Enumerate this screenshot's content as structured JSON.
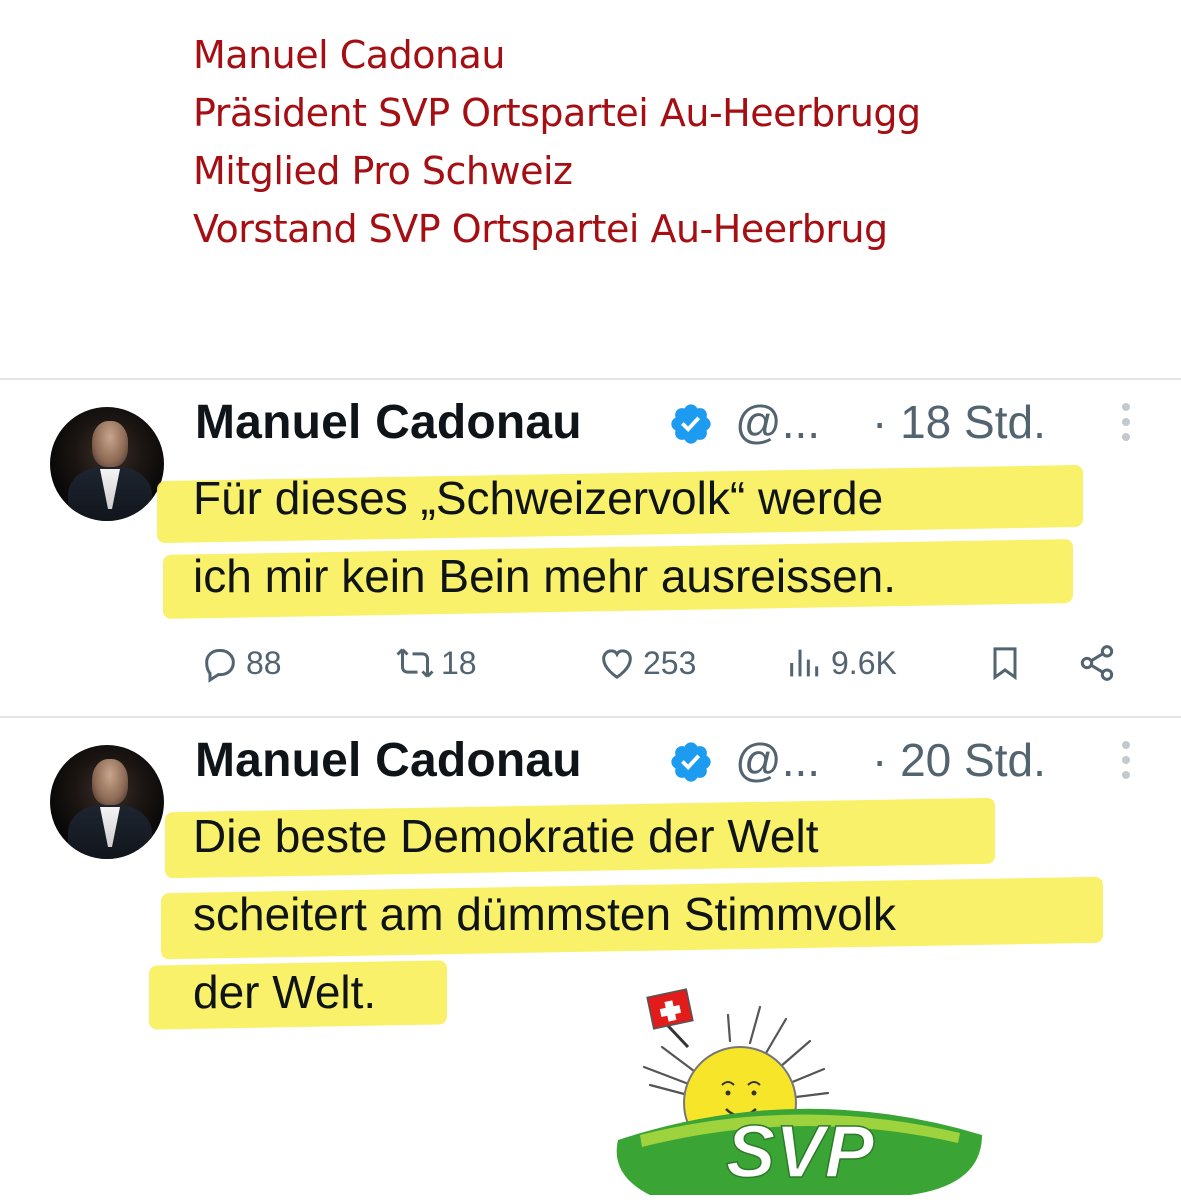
{
  "caption": {
    "lines": [
      "Manuel Cadonau",
      "Präsident SVP Ortspartei Au-Heerbrugg",
      "Mitglied Pro Schweiz",
      "Vorstand SVP Ortspartei Au-Heerbrug"
    ],
    "color": "#a50e12"
  },
  "tweets": [
    {
      "name": "Manuel Cadonau",
      "handle": "@...",
      "time": "· 18 Std.",
      "text_lines": [
        "Für dieses „Schweizervolk“ werde",
        "ich mir kein Bein mehr ausreissen."
      ],
      "stats": {
        "replies": "88",
        "reposts": "18",
        "likes": "253",
        "views": "9.6K"
      }
    },
    {
      "name": "Manuel Cadonau",
      "handle": "@...",
      "time": "· 20 Std.",
      "text_lines": [
        "Die beste Demokratie der Welt",
        "scheitert am dümmsten Stimmvolk",
        "der Welt."
      ]
    }
  ],
  "logo": {
    "text": "SVP"
  },
  "colors": {
    "highlight": "#f8f05d",
    "verified": "#1d9bf0",
    "svp_green": "#3aa535",
    "muted": "#536471"
  }
}
